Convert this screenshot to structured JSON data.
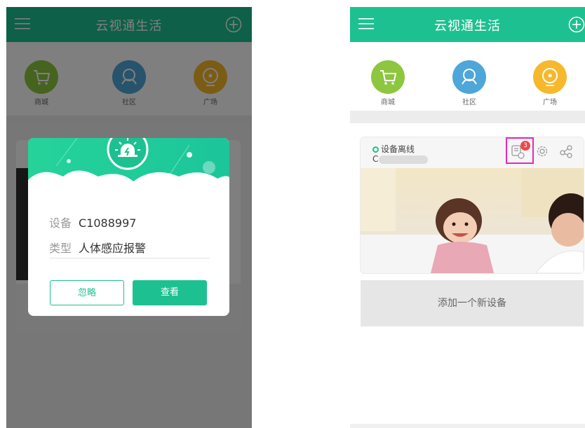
{
  "app": {
    "title": "云视通生活"
  },
  "quick_nav": [
    {
      "label": "商城",
      "icon": "cart-icon",
      "color": "#8dc63f"
    },
    {
      "label": "社区",
      "icon": "community-icon",
      "color": "#4fa6d9"
    },
    {
      "label": "广场",
      "icon": "plaza-icon",
      "color": "#f7b82b"
    }
  ],
  "alarm_dialog": {
    "device_key": "设备",
    "device_value": "C1088997",
    "type_key": "类型",
    "type_value": "人体感应报警",
    "ignore_label": "忽略",
    "view_label": "查看"
  },
  "device_card": {
    "status": "设备离线",
    "name_prefix": "C",
    "message_count": "3"
  },
  "add_device_label": "添加一个新设备",
  "colors": {
    "accent": "#1dc191",
    "badge": "#e84b4b",
    "highlight": "#e528b8"
  }
}
